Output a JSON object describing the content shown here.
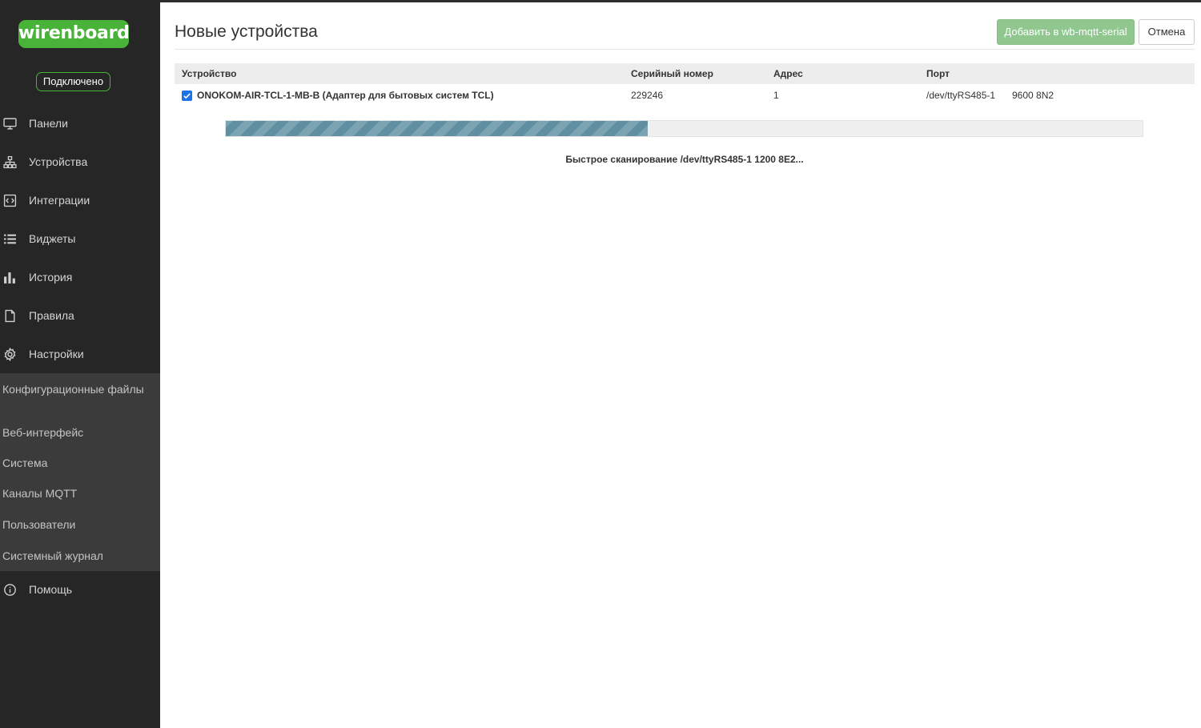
{
  "sidebar": {
    "logo": "wirenboard",
    "status": "Подключено",
    "nav": [
      {
        "label": "Панели",
        "icon": "monitor-icon"
      },
      {
        "label": "Устройства",
        "icon": "network-icon"
      },
      {
        "label": "Интеграции",
        "icon": "code-box-icon"
      },
      {
        "label": "Виджеты",
        "icon": "list-icon"
      },
      {
        "label": "История",
        "icon": "bar-chart-icon"
      },
      {
        "label": "Правила",
        "icon": "file-icon"
      },
      {
        "label": "Настройки",
        "icon": "gear-icon"
      }
    ],
    "settings_submenu": [
      "Конфигурационные файлы",
      "Веб-интерфейс",
      "Система",
      "Каналы MQTT",
      "Пользователи",
      "Системный журнал"
    ],
    "help": {
      "label": "Помощь",
      "icon": "info-circle-icon"
    }
  },
  "header": {
    "title": "Новые устройства",
    "add_button": "Добавить в wb-mqtt-serial",
    "cancel_button": "Отмена"
  },
  "table": {
    "columns": [
      "Устройство",
      "Серийный номер",
      "Адрес",
      "Порт"
    ],
    "rows": [
      {
        "checked": true,
        "device": "ONOKOM-AIR-TCL-1-MB-B (Адаптер для бытовых систем TCL)",
        "serial": "229246",
        "address": "1",
        "port": "/dev/ttyRS485-1",
        "port_settings": "9600 8N2"
      }
    ]
  },
  "scan": {
    "progress_fraction": 0.46,
    "status_text": "Быстрое сканирование /dev/ttyRS485-1 1200 8E2..."
  },
  "colors": {
    "sidebar_bg": "#262626",
    "brand_green": "#49b239",
    "add_button_bg": "#8fc78f",
    "progress_fill": "#5f8fa0",
    "checkbox": "#1a73e8"
  }
}
